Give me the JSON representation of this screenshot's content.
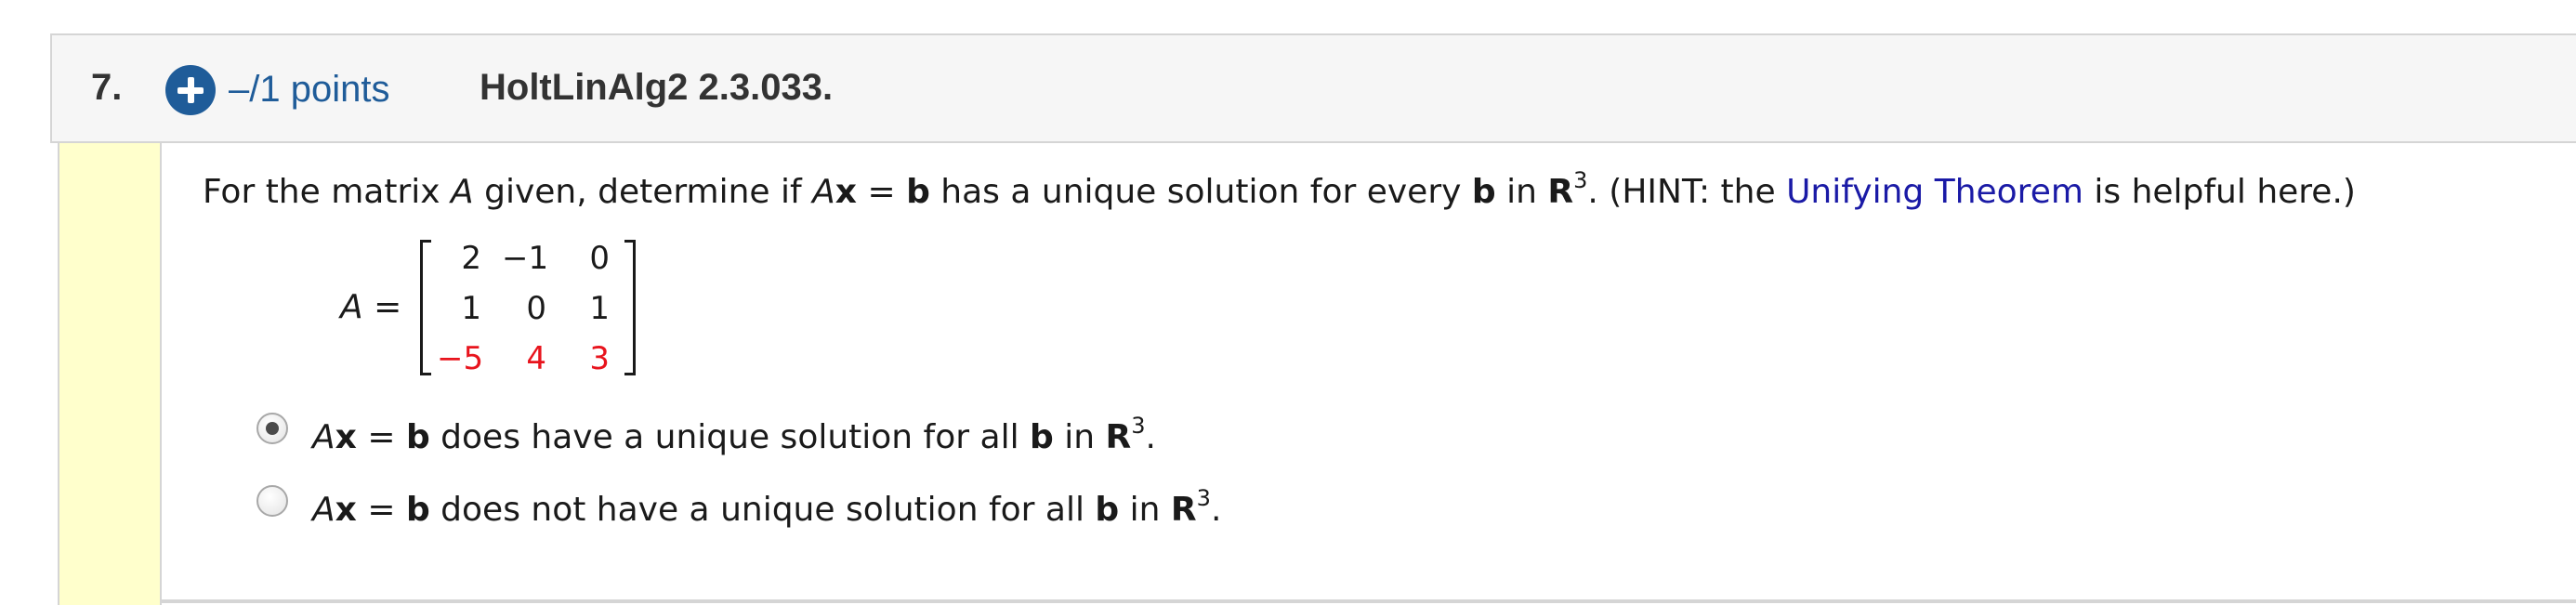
{
  "question": {
    "number": "7.",
    "points": "–/1 points",
    "id": "HoltLinAlg2 2.3.033."
  },
  "prompt": {
    "lead": "For the matrix ",
    "matrix_var": "A",
    "given": " given, determine if  ",
    "eq_A": "A",
    "eq_x": "x",
    "eq_equals": " = ",
    "eq_b": "b",
    "mid": "  has a unique solution for every ",
    "every_b": "b",
    "in_text": " in ",
    "space": "R",
    "exponent": "3",
    "hint_start": ". (HINT: the ",
    "hint_link": "Unifying Theorem",
    "hint_end": " is helpful here.)"
  },
  "matrix": {
    "label_var": "A",
    "label_eq": " =",
    "rows": [
      [
        {
          "v": "2",
          "color": "#1a1a1a"
        },
        {
          "v": "−1",
          "color": "#1a1a1a"
        },
        {
          "v": "0",
          "color": "#1a1a1a"
        }
      ],
      [
        {
          "v": "1",
          "color": "#1a1a1a"
        },
        {
          "v": "0",
          "color": "#1a1a1a"
        },
        {
          "v": "1",
          "color": "#1a1a1a"
        }
      ],
      [
        {
          "v": "−5",
          "color": "#e8141d"
        },
        {
          "v": "4",
          "color": "#e8141d"
        },
        {
          "v": "3",
          "color": "#e8141d"
        }
      ]
    ]
  },
  "choices": [
    {
      "selected": true,
      "A": "A",
      "x": "x",
      "equals": " = ",
      "b": "b",
      "text": " does have a unique solution for all ",
      "b2": "b",
      "in_text": " in ",
      "space": "R",
      "exponent": "3",
      "end": "."
    },
    {
      "selected": false,
      "A": "A",
      "x": "x",
      "equals": " = ",
      "b": "b",
      "text": " does not have a unique solution for all ",
      "b2": "b",
      "in_text": " in ",
      "space": "R",
      "exponent": "3",
      "end": "."
    }
  ],
  "colors": {
    "accent_blue": "#1f5c99",
    "link_blue": "#1a1aa6",
    "matrix_red": "#e8141d",
    "answer_bar": "#ffffcc",
    "header_bg": "#f6f6f6"
  }
}
